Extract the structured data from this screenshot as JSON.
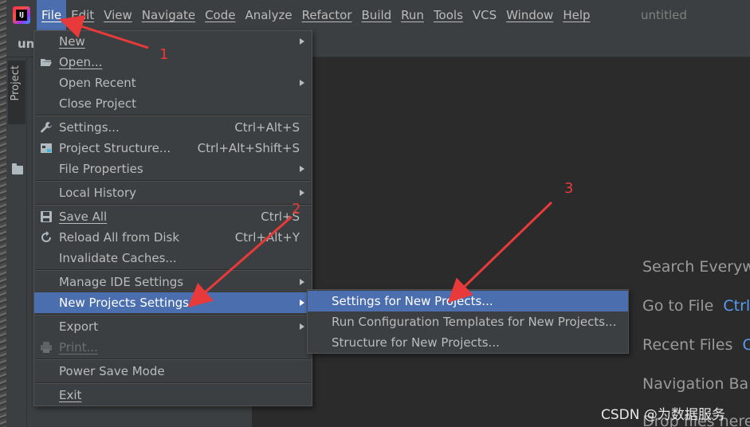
{
  "window": {
    "title": "untitled"
  },
  "menubar": {
    "logo_text": "IJ",
    "items": [
      {
        "label": "File"
      },
      {
        "label": "Edit"
      },
      {
        "label": "View"
      },
      {
        "label": "Navigate"
      },
      {
        "label": "Code"
      },
      {
        "label": "Analyze"
      },
      {
        "label": "Refactor"
      },
      {
        "label": "Build"
      },
      {
        "label": "Run"
      },
      {
        "label": "Tools"
      },
      {
        "label": "VCS"
      },
      {
        "label": "Window"
      },
      {
        "label": "Help"
      }
    ]
  },
  "navbar": {
    "crumb": "unt"
  },
  "tool_stripe": {
    "project_label": "Project"
  },
  "file_menu": {
    "items": [
      {
        "label": "New",
        "shortcut": "",
        "submenu": true
      },
      {
        "label": "Open...",
        "shortcut": "",
        "submenu": false,
        "icon": "folder-open-icon"
      },
      {
        "label": "Open Recent",
        "shortcut": "",
        "submenu": true
      },
      {
        "label": "Close Project",
        "shortcut": "",
        "submenu": false
      },
      {
        "label": "Settings...",
        "shortcut": "Ctrl+Alt+S",
        "submenu": false,
        "icon": "wrench-icon"
      },
      {
        "label": "Project Structure...",
        "shortcut": "Ctrl+Alt+Shift+S",
        "submenu": false,
        "icon": "project-structure-icon"
      },
      {
        "label": "File Properties",
        "shortcut": "",
        "submenu": true
      },
      {
        "label": "Local History",
        "shortcut": "",
        "submenu": true
      },
      {
        "label": "Save All",
        "shortcut": "Ctrl+S",
        "submenu": false,
        "icon": "save-icon"
      },
      {
        "label": "Reload All from Disk",
        "shortcut": "Ctrl+Alt+Y",
        "submenu": false,
        "icon": "reload-icon"
      },
      {
        "label": "Invalidate Caches...",
        "shortcut": "",
        "submenu": false
      },
      {
        "label": "Manage IDE Settings",
        "shortcut": "",
        "submenu": true
      },
      {
        "label": "New Projects Settings",
        "shortcut": "",
        "submenu": true
      },
      {
        "label": "Export",
        "shortcut": "",
        "submenu": true
      },
      {
        "label": "Print...",
        "shortcut": "",
        "submenu": false,
        "icon": "printer-icon"
      },
      {
        "label": "Power Save Mode",
        "shortcut": "",
        "submenu": false
      },
      {
        "label": "Exit",
        "shortcut": "",
        "submenu": false
      }
    ]
  },
  "new_projects_submenu": {
    "items": [
      {
        "label": "Settings for New Projects..."
      },
      {
        "label": "Run Configuration Templates for New Projects..."
      },
      {
        "label": "Structure for New Projects..."
      }
    ]
  },
  "welcome_hints": {
    "search": {
      "label": "Search Everyw",
      "shortcut": ""
    },
    "goto_file": {
      "label": "Go to File",
      "shortcut": "Ctrl"
    },
    "recent_files": {
      "label": "Recent Files",
      "shortcut": "C"
    },
    "navigation_bar": {
      "label": "Navigation Ba",
      "shortcut": ""
    },
    "drop_files": {
      "label": "Drop files here",
      "shortcut": ""
    }
  },
  "annotations": {
    "step1": "1",
    "step2": "2",
    "step3": "3",
    "color": "#e83a3a"
  },
  "watermark": "CSDN @为数据服务",
  "colors": {
    "highlight": "#4b6eaf",
    "menu_bg": "#3c3f41",
    "editor_bg": "#2b2b2b",
    "shortcut_link": "#589df6"
  }
}
